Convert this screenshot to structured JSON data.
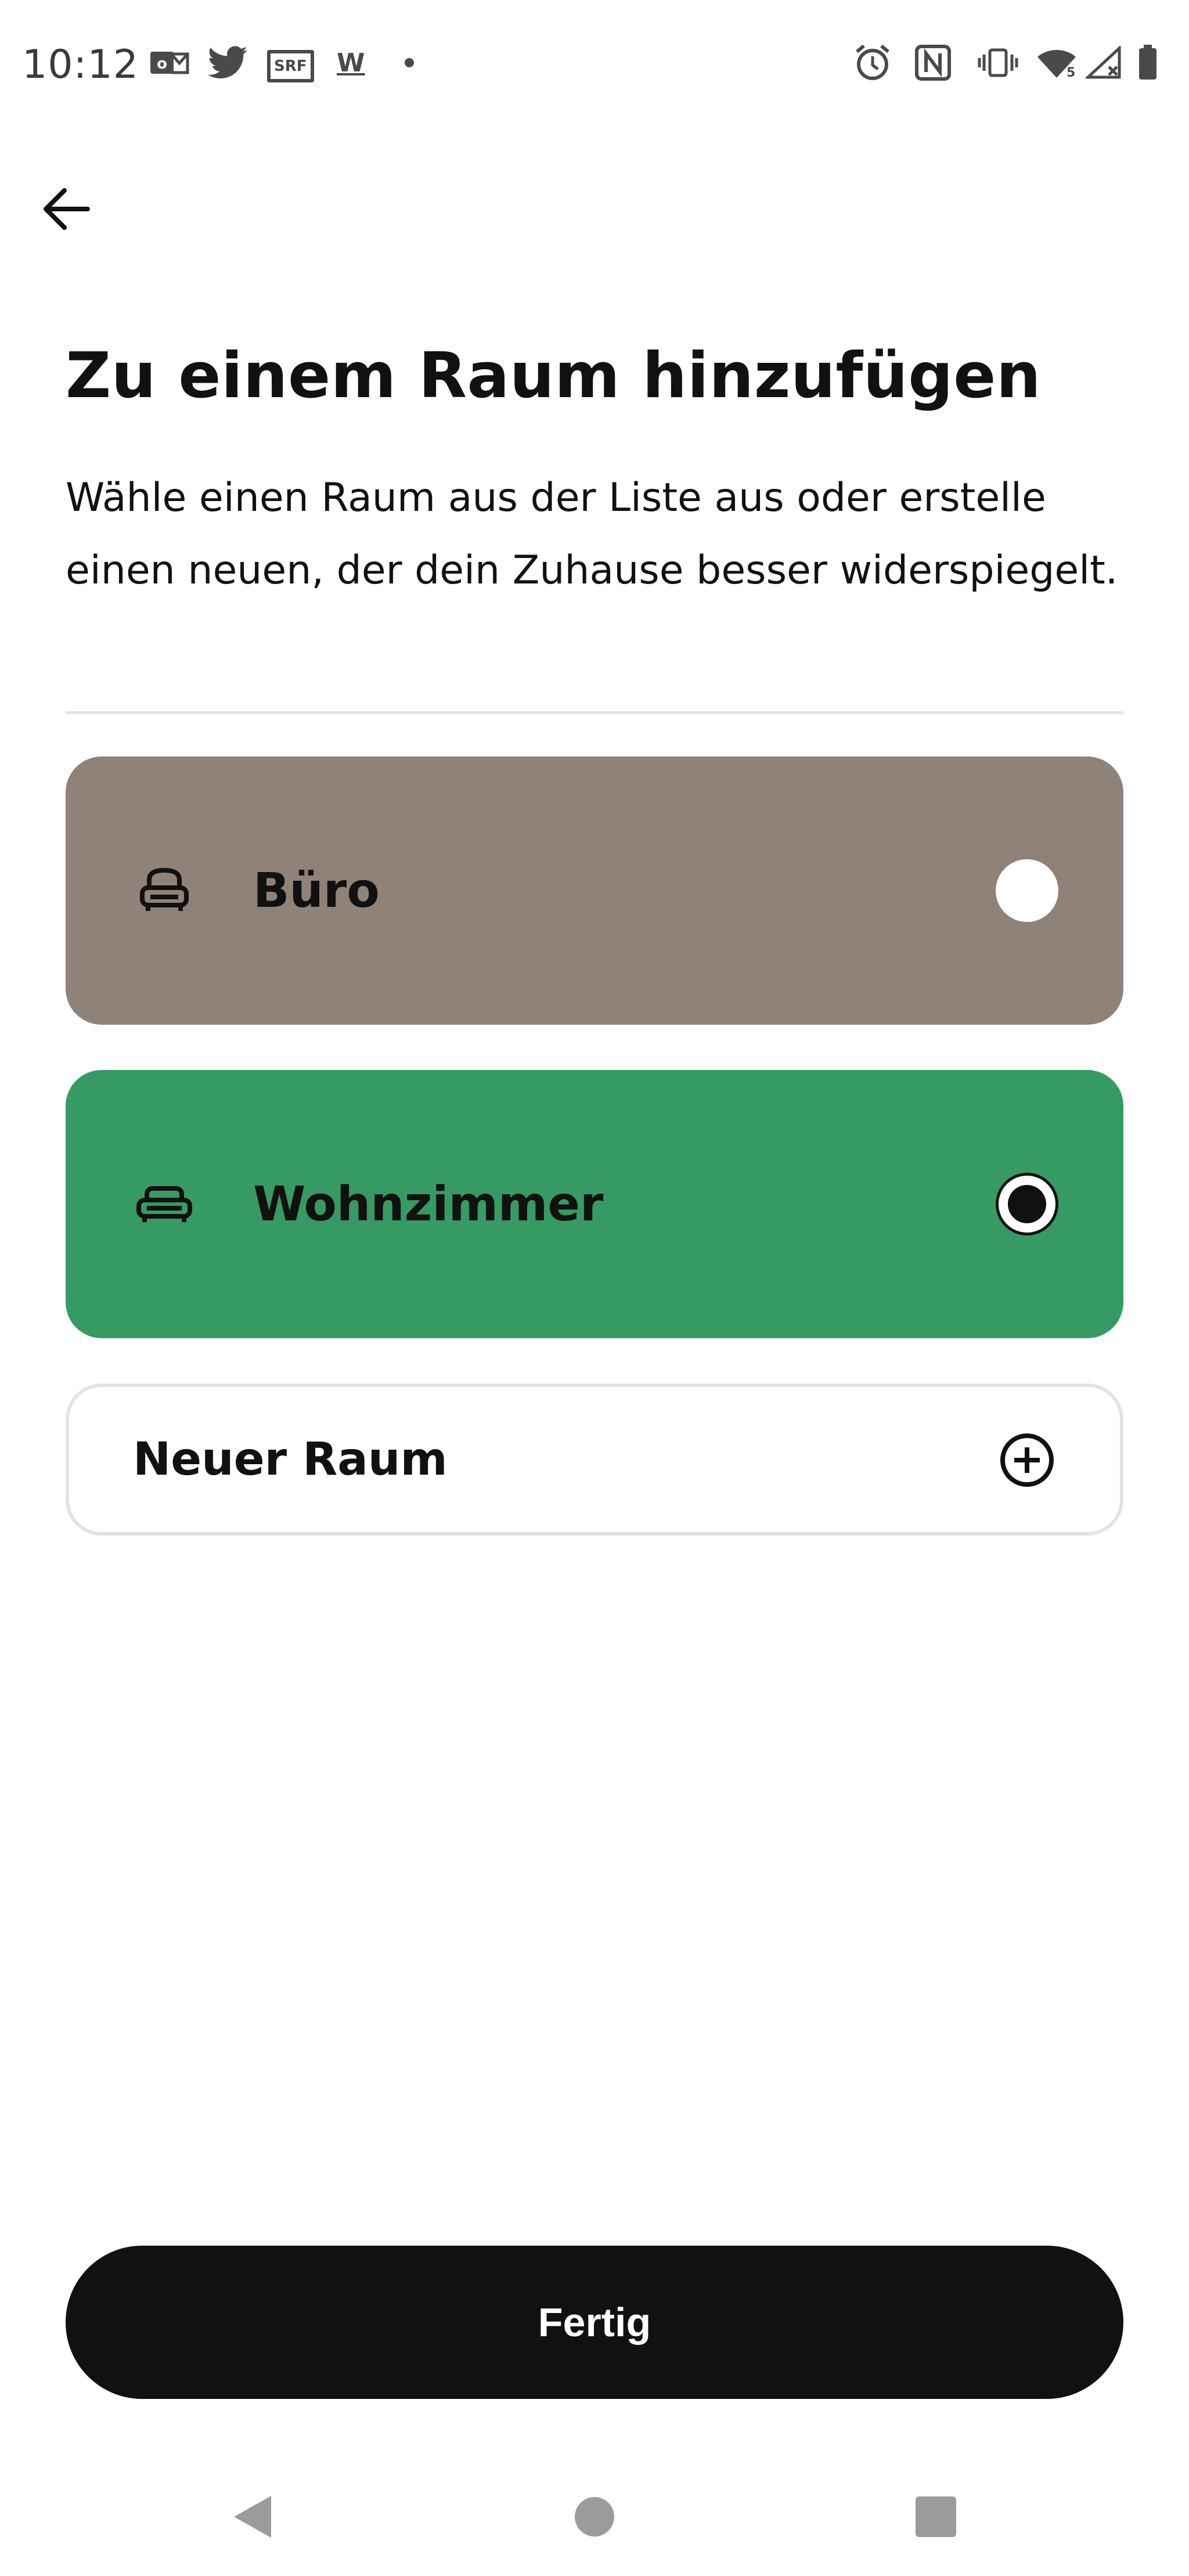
{
  "status_bar": {
    "time": "10:12",
    "sbb_label": "SRF",
    "w_label": "W",
    "network_label": "5",
    "icons": [
      "mail-icon",
      "twitter-icon",
      "srf-icon",
      "w-icon",
      "dot-icon",
      "alarm-icon",
      "nfc-icon",
      "vibrate-icon",
      "wifi-icon",
      "signal-icon",
      "battery-icon"
    ]
  },
  "header": {
    "back_icon": "arrow-left-icon"
  },
  "main": {
    "title": "Zu einem Raum hinzufügen",
    "description": "Wähle einen Raum aus der Liste aus oder erstelle einen neuen, der dein Zuhause besser widerspiegelt.",
    "rooms": [
      {
        "label": "Büro",
        "icon": "armchair-icon",
        "color": "#8f8279",
        "selected": false
      },
      {
        "label": "Wohnzimmer",
        "icon": "sofa-icon",
        "color": "#359b62",
        "selected": true
      }
    ],
    "new_room": {
      "label": "Neuer Raum",
      "icon": "plus-circle-icon"
    }
  },
  "footer": {
    "done_label": "Fertig"
  },
  "nav": {
    "icons": [
      "back-triangle-icon",
      "home-circle-icon",
      "recents-square-icon"
    ]
  },
  "colors": {
    "background": "#ffffff",
    "text": "#111111",
    "room_buero": "#8f8279",
    "room_wohnzimmer": "#359b62",
    "button": "#111111"
  }
}
